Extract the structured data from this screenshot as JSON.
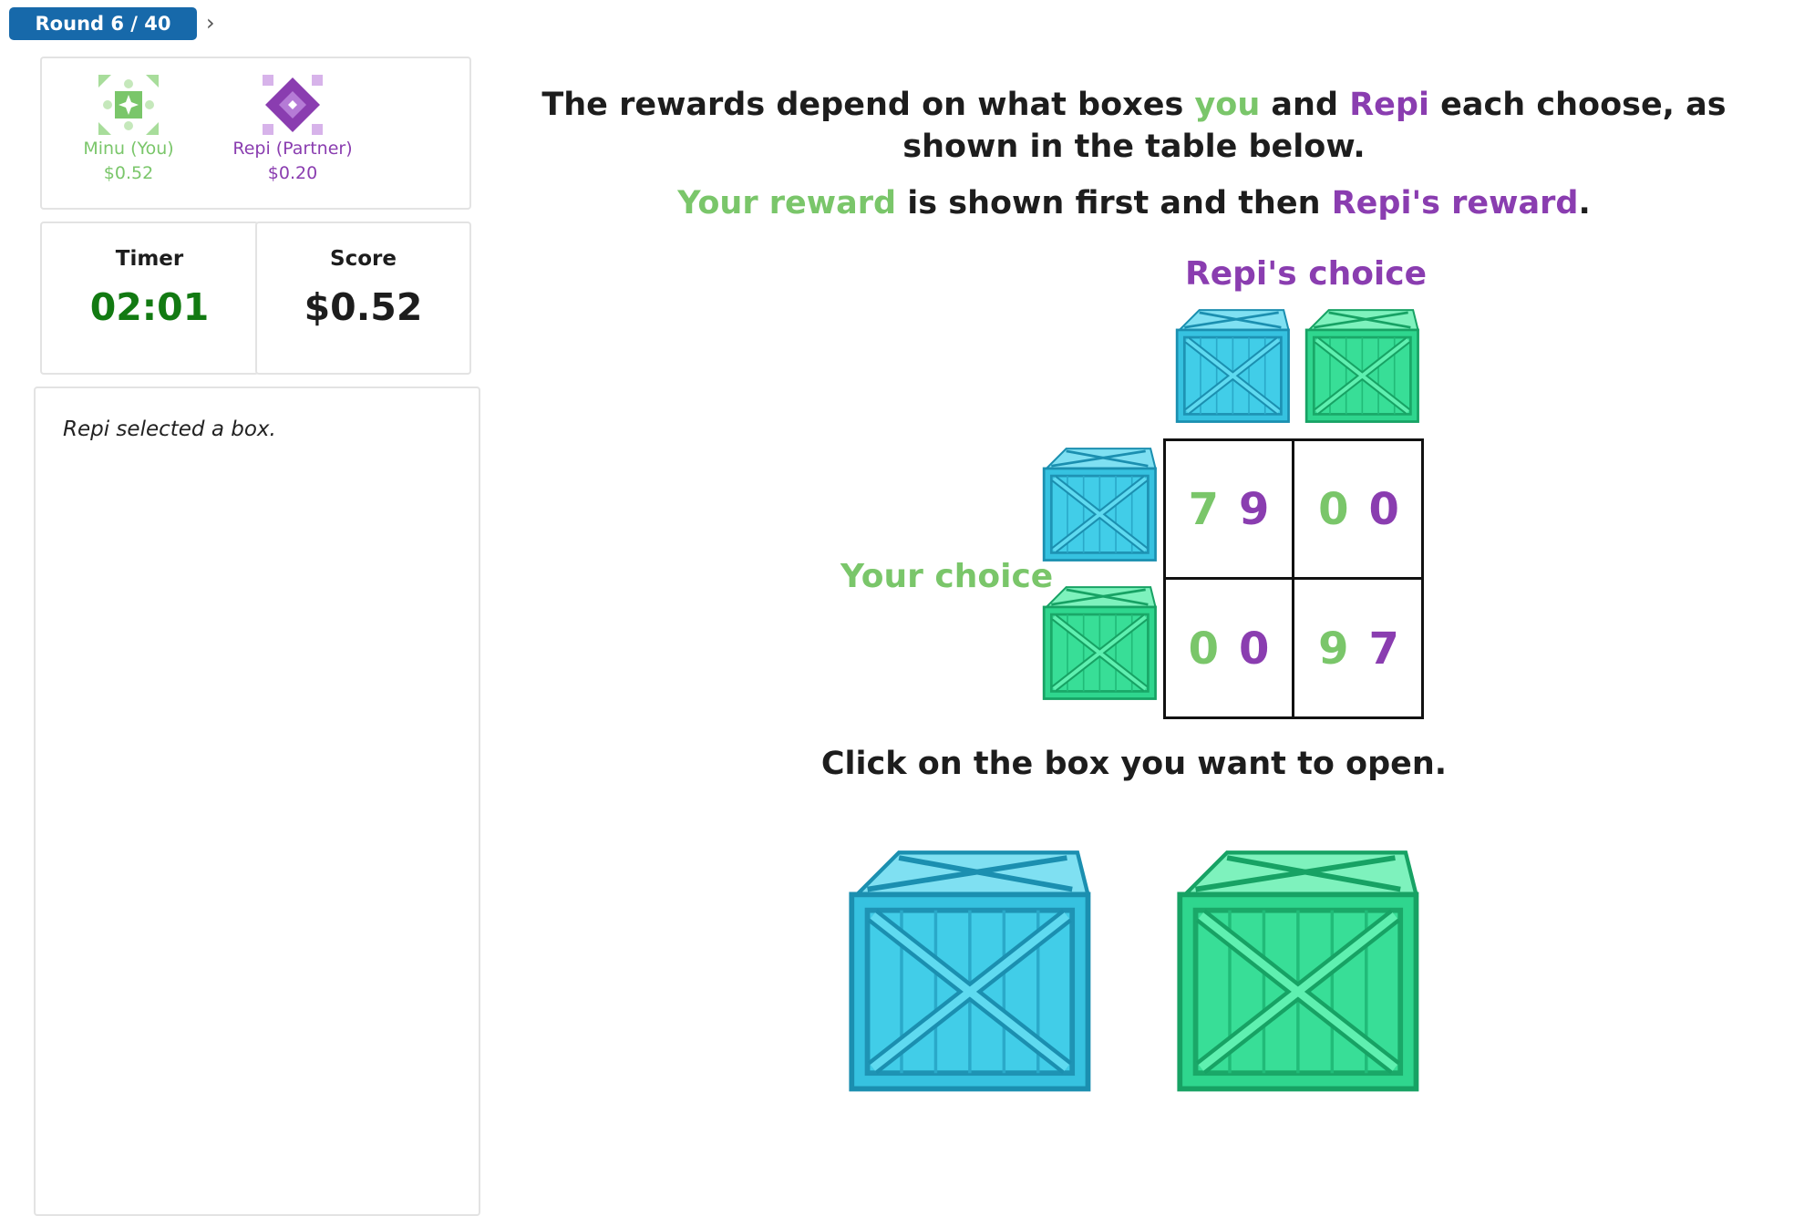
{
  "round": {
    "label": "Round 6 / 40",
    "chevron": "›"
  },
  "players": [
    {
      "name": "Minu (You)",
      "amount": "$0.52",
      "color": "#7ac66a",
      "icon": "green-quilt-avatar-icon"
    },
    {
      "name": "Repi (Partner)",
      "amount": "$0.20",
      "color": "#8a3db0",
      "icon": "purple-diamond-avatar-icon"
    }
  ],
  "timer": {
    "label": "Timer",
    "value": "02:01"
  },
  "score": {
    "label": "Score",
    "value": "$0.52"
  },
  "log": {
    "message": "Repi selected a box."
  },
  "headline": {
    "part1": "The rewards depend on what boxes ",
    "you": "you",
    "part2": " and ",
    "repi": "Repi",
    "part3": " each choose, as shown in the table below."
  },
  "subheadline": {
    "your_reward": "Your reward",
    "middle": " is shown first and then ",
    "repi_reward": "Repi's reward",
    "end": "."
  },
  "matrix": {
    "column_title": "Repi's choice",
    "row_title": "Your choice",
    "cells": [
      [
        {
          "you": "7",
          "partner": "9"
        },
        {
          "you": "0",
          "partner": "0"
        }
      ],
      [
        {
          "you": "0",
          "partner": "0"
        },
        {
          "you": "9",
          "partner": "7"
        }
      ]
    ]
  },
  "instruction": "Click on the box you want to open.",
  "colors": {
    "you": "#7ac66a",
    "partner": "#8a3db0",
    "blue_box": "#36c2e0",
    "green_box": "#2fd68e",
    "round_badge": "#1769aa",
    "timer": "#127a12"
  }
}
